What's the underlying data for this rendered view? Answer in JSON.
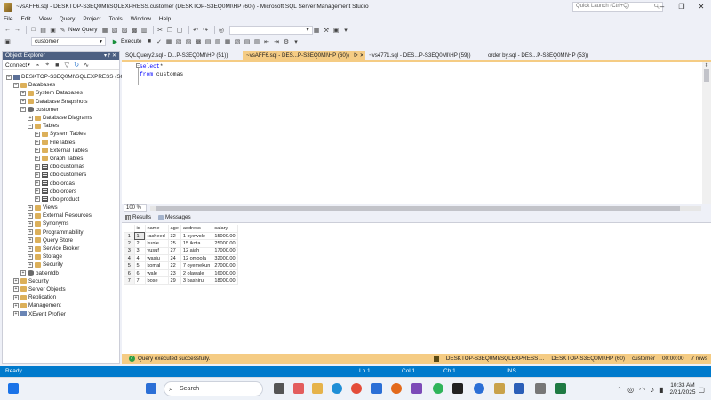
{
  "window": {
    "title": "~vsAFF6.sql - DESKTOP-S3EQ0MI\\SQLEXPRESS.customer (DESKTOP-S3EQ0MI\\HP (60)) - Microsoft SQL Server Management Studio",
    "quick_launch_placeholder": "Quick Launch (Ctrl+Q)"
  },
  "menu": [
    "File",
    "Edit",
    "View",
    "Query",
    "Project",
    "Tools",
    "Window",
    "Help"
  ],
  "toolbar": {
    "new_query": "New Query",
    "database": "customer",
    "execute": "Execute"
  },
  "object_explorer": {
    "title": "Object Explorer",
    "connect": "Connect",
    "tree": [
      {
        "label": "DESKTOP-S3EQ0MI\\SQLEXPRESS (SQL S",
        "level": 0,
        "icon": "server",
        "exp": "−"
      },
      {
        "label": "Databases",
        "level": 1,
        "icon": "folder",
        "exp": "−"
      },
      {
        "label": "System Databases",
        "level": 2,
        "icon": "folder",
        "exp": "+"
      },
      {
        "label": "Database Snapshots",
        "level": 2,
        "icon": "folder",
        "exp": "+"
      },
      {
        "label": "customer",
        "level": 2,
        "icon": "db",
        "exp": "−"
      },
      {
        "label": "Database Diagrams",
        "level": 3,
        "icon": "folder",
        "exp": "+"
      },
      {
        "label": "Tables",
        "level": 3,
        "icon": "folder",
        "exp": "−"
      },
      {
        "label": "System Tables",
        "level": 4,
        "icon": "folder",
        "exp": "+"
      },
      {
        "label": "FileTables",
        "level": 4,
        "icon": "folder",
        "exp": "+"
      },
      {
        "label": "External Tables",
        "level": 4,
        "icon": "folder",
        "exp": "+"
      },
      {
        "label": "Graph Tables",
        "level": 4,
        "icon": "folder",
        "exp": "+"
      },
      {
        "label": "dbo.customas",
        "level": 4,
        "icon": "table",
        "exp": "+"
      },
      {
        "label": "dbo.customers",
        "level": 4,
        "icon": "table",
        "exp": "+"
      },
      {
        "label": "dbo.ordas",
        "level": 4,
        "icon": "table",
        "exp": "+"
      },
      {
        "label": "dbo.orders",
        "level": 4,
        "icon": "table",
        "exp": "+"
      },
      {
        "label": "dbo.product",
        "level": 4,
        "icon": "table",
        "exp": "+"
      },
      {
        "label": "Views",
        "level": 3,
        "icon": "folder",
        "exp": "+"
      },
      {
        "label": "External Resources",
        "level": 3,
        "icon": "folder",
        "exp": "+"
      },
      {
        "label": "Synonyms",
        "level": 3,
        "icon": "folder",
        "exp": "+"
      },
      {
        "label": "Programmability",
        "level": 3,
        "icon": "folder",
        "exp": "+"
      },
      {
        "label": "Query Store",
        "level": 3,
        "icon": "folder",
        "exp": "+"
      },
      {
        "label": "Service Broker",
        "level": 3,
        "icon": "folder",
        "exp": "+"
      },
      {
        "label": "Storage",
        "level": 3,
        "icon": "folder",
        "exp": "+"
      },
      {
        "label": "Security",
        "level": 3,
        "icon": "folder",
        "exp": "+"
      },
      {
        "label": "patientdb",
        "level": 2,
        "icon": "db",
        "exp": "+"
      },
      {
        "label": "Security",
        "level": 1,
        "icon": "folder",
        "exp": "+"
      },
      {
        "label": "Server Objects",
        "level": 1,
        "icon": "folder",
        "exp": "+"
      },
      {
        "label": "Replication",
        "level": 1,
        "icon": "folder",
        "exp": "+"
      },
      {
        "label": "Management",
        "level": 1,
        "icon": "folder",
        "exp": "+"
      },
      {
        "label": "XEvent Profiler",
        "level": 1,
        "icon": "xevent",
        "exp": "+"
      }
    ]
  },
  "tabs": [
    {
      "label": "SQLQuery2.sql - D...P-S3EQ0MI\\HP (51))",
      "active": false,
      "pin": ""
    },
    {
      "label": "~vsAFF6.sql - DES...P-S3EQ0MI\\HP (60))",
      "active": true,
      "pin": "ᐅ"
    },
    {
      "label": "~vs4771.sql - DES...P-S3EQ0MI\\HP (59))",
      "active": false,
      "pin": ""
    },
    {
      "label": "order by.sql - DES...P-S3EQ0MI\\HP (53))",
      "active": false,
      "pin": ""
    }
  ],
  "editor": {
    "line1_kw": "select",
    "line1_rest": "*",
    "line2_kw": "from",
    "line2_rest": " customas",
    "zoom": "100 %"
  },
  "results": {
    "tab_results": "Results",
    "tab_messages": "Messages",
    "columns": [
      "id",
      "name",
      "age",
      "address",
      "salary"
    ],
    "rows": [
      [
        "1",
        "rasheed",
        "32",
        "1 oyewole",
        "15000.00"
      ],
      [
        "2",
        "kunle",
        "25",
        "15 ikota",
        "25000.00"
      ],
      [
        "3",
        "yusuf",
        "27",
        "12 ajah",
        "17000.00"
      ],
      [
        "4",
        "wasiu",
        "24",
        "12 omoola",
        "32000.00"
      ],
      [
        "5",
        "komal",
        "22",
        "7 oyemekun",
        "27000.00"
      ],
      [
        "6",
        "wale",
        "23",
        "2 olawale",
        "16000.00"
      ],
      [
        "7",
        "bose",
        "29",
        "3 bashiru",
        "18000.00"
      ]
    ]
  },
  "exec_status": {
    "message": "Query executed successfully.",
    "server": "DESKTOP-S3EQ0MI\\SQLEXPRESS ...",
    "user": "DESKTOP-S3EQ0MI\\HP (60)",
    "database": "customer",
    "elapsed": "00:00:00",
    "rows": "7 rows"
  },
  "statusbar": {
    "ready": "Ready",
    "ln": "Ln 1",
    "col": "Col 1",
    "ch": "Ch 1",
    "ins": "INS"
  },
  "taskbar": {
    "search": "Search",
    "time": "10:33 AM",
    "date": "2/21/2025"
  },
  "colors": {
    "accent": "#007acc",
    "active_tab": "#f5cc84",
    "oe_header": "#4d6082",
    "keyword": "#0000ff"
  }
}
